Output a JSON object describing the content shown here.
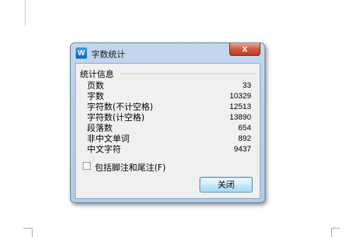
{
  "dialog": {
    "title": "字数统计",
    "app_icon_letter": "W",
    "close_glyph": "x",
    "group_label": "统计信息",
    "stats": [
      {
        "label": "页数",
        "value": "33"
      },
      {
        "label": "字数",
        "value": "10329"
      },
      {
        "label": "字符数(不计空格)",
        "value": "12513"
      },
      {
        "label": "字符数(计空格)",
        "value": "13890"
      },
      {
        "label": "段落数",
        "value": "654"
      },
      {
        "label": "非中文单词",
        "value": "892"
      },
      {
        "label": "中文字符",
        "value": "9437"
      }
    ],
    "checkbox_label": "包括脚注和尾注(F)",
    "checkbox_checked": false,
    "close_button_label": "关闭"
  }
}
